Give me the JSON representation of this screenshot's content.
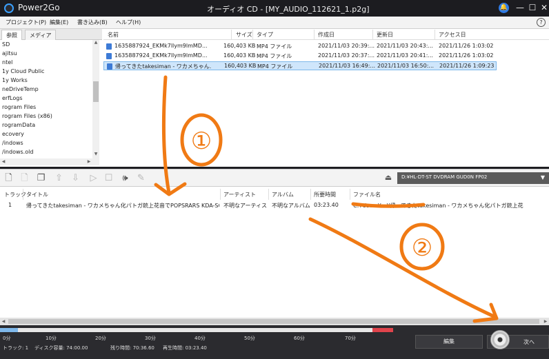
{
  "titlebar": {
    "app_name": "Power2Go",
    "window_title": "オーディオ CD - [MY_AUDIO_112621_1.p2g]",
    "min": "—",
    "max": "☐",
    "close": "✕"
  },
  "menu": {
    "items": [
      "プロジェクト(P)",
      "編集(E)",
      "書き込み(B)",
      "ヘルプ(H)"
    ],
    "help": "?"
  },
  "browser": {
    "tabs": [
      "参照",
      "メディア"
    ],
    "tree_items": [
      "SD",
      "ajitsu",
      "ntel",
      "1y Cloud Public",
      "1y Works",
      "neDriveTemp",
      "erfLogs",
      "rogram Files",
      "rogram Files (x86)",
      "rogramData",
      "ecovery",
      "/indows",
      "/indows.old"
    ],
    "columns": [
      "名前",
      "サイズ",
      "タイプ",
      "作成日",
      "更新日",
      "アクセス日"
    ],
    "files": [
      {
        "name": "1635887924_EKMk7llym9lmMD...",
        "size": "160,403 KB",
        "type": "MP4 ファイル",
        "created": "2021/11/03 20:39:...",
        "modified": "2021/11/03 20:43:...",
        "accessed": "2021/11/26 1:03:02"
      },
      {
        "name": "1635887924_EKMk7llym9lmMD...",
        "size": "160,403 KB",
        "type": "MP4 ファイル",
        "created": "2021/11/03 20:37:...",
        "modified": "2021/11/03 20:41:...",
        "accessed": "2021/11/26 1:03:02"
      },
      {
        "name": "帰ってきたtakesiman - ワカメちゃん...",
        "size": "160,403 KB",
        "type": "MP4 ファイル",
        "created": "2021/11/03 16:49:...",
        "modified": "2021/11/03 16:50:...",
        "accessed": "2021/11/26 1:09:23"
      }
    ]
  },
  "toolbar": {
    "drive": "D:¥HL-DT-ST DVDRAM GUD0N FP02"
  },
  "tracks": {
    "columns": [
      "トラック",
      "タイトル",
      "アーティスト",
      "アルバム",
      "所要時間",
      "ファイル名"
    ],
    "rows": [
      {
        "track": "1",
        "title": "帰ってきたtakesiman - ワカメちゃん化パトガ銃上花音でPOPSRARS KDA-SOLO",
        "artist": "不明なアーティスト",
        "album": "不明なアルバム",
        "duration": "03:23.40",
        "filename": "C:¥Users¥...¥帰ってきたtakesiman - ワカメちゃん化パトガ銃上花"
      }
    ]
  },
  "capacity": {
    "ticks": [
      "0分",
      "10分",
      "20分",
      "30分",
      "40分",
      "50分",
      "60分",
      "70分"
    ],
    "used_minutes": 3.39,
    "max_minutes": 74
  },
  "status": {
    "tracks": "トラック: 1",
    "disc": "ディスク容量: 74:00.00",
    "remaining": "残り時間: 70:36.60",
    "playtime": "再生時間: 03:23.40"
  },
  "buttons": {
    "edit": "編集",
    "next": "次へ"
  },
  "annotations": {
    "one": "①",
    "two": "②"
  },
  "colors": {
    "annotation": "#f07a14",
    "accent": "#2f7be5",
    "selection": "#cfe6fb",
    "over_capacity": "#e0444c"
  }
}
